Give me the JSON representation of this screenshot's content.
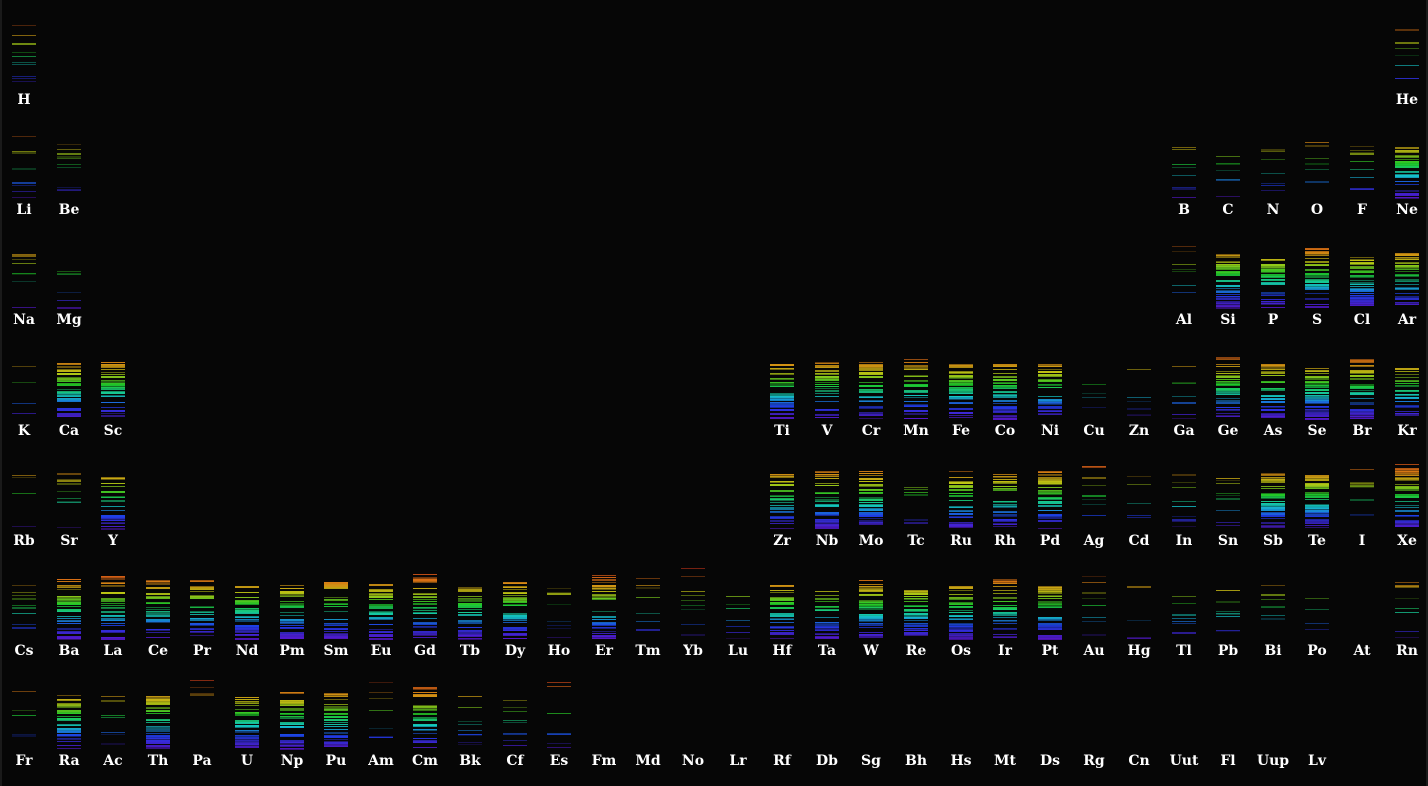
{
  "periodic_table": {
    "rows": [
      [
        "H",
        "",
        "",
        "",
        "",
        "",
        "",
        "",
        "",
        "",
        "",
        "",
        "",
        "",
        "",
        "",
        "",
        "",
        "",
        "",
        "",
        "",
        "",
        "",
        "",
        "",
        "",
        "",
        "",
        "",
        "",
        "He"
      ],
      [
        "Li",
        "Be",
        "",
        "",
        "",
        "",
        "",
        "",
        "",
        "",
        "",
        "",
        "",
        "",
        "",
        "",
        "",
        "",
        "",
        "",
        "",
        "",
        "",
        "",
        "",
        "",
        "B",
        "C",
        "N",
        "O",
        "F",
        "Ne"
      ],
      [
        "Na",
        "Mg",
        "",
        "",
        "",
        "",
        "",
        "",
        "",
        "",
        "",
        "",
        "",
        "",
        "",
        "",
        "",
        "",
        "",
        "",
        "",
        "",
        "",
        "",
        "",
        "",
        "Al",
        "Si",
        "P",
        "S",
        "Cl",
        "Ar"
      ],
      [
        "K",
        "Ca",
        "Sc",
        "",
        "",
        "",
        "",
        "",
        "",
        "",
        "",
        "",
        "",
        "",
        "",
        "",
        "",
        "Ti",
        "V",
        "Cr",
        "Mn",
        "Fe",
        "Co",
        "Ni",
        "Cu",
        "Zn",
        "Ga",
        "Ge",
        "As",
        "Se",
        "Br",
        "Kr"
      ],
      [
        "Rb",
        "Sr",
        "Y",
        "",
        "",
        "",
        "",
        "",
        "",
        "",
        "",
        "",
        "",
        "",
        "",
        "",
        "",
        "Zr",
        "Nb",
        "Mo",
        "Tc",
        "Ru",
        "Rh",
        "Pd",
        "Ag",
        "Cd",
        "In",
        "Sn",
        "Sb",
        "Te",
        "I",
        "Xe"
      ],
      [
        "Cs",
        "Ba",
        "La",
        "Ce",
        "Pr",
        "Nd",
        "Pm",
        "Sm",
        "Eu",
        "Gd",
        "Tb",
        "Dy",
        "Ho",
        "Er",
        "Tm",
        "Yb",
        "Lu",
        "Hf",
        "Ta",
        "W",
        "Re",
        "Os",
        "Ir",
        "Pt",
        "Au",
        "Hg",
        "Tl",
        "Pb",
        "Bi",
        "Po",
        "At",
        "Rn"
      ],
      [
        "Fr",
        "Ra",
        "Ac",
        "Th",
        "Pa",
        "U",
        "Np",
        "Pu",
        "Am",
        "Cm",
        "Bk",
        "Cf",
        "Es",
        "Fm",
        "Md",
        "No",
        "Lr",
        "Rf",
        "Db",
        "Sg",
        "Bh",
        "Hs",
        "Mt",
        "Ds",
        "Rg",
        "Cn",
        "Uut",
        "Fl",
        "Uup",
        "Lv",
        "",
        ""
      ]
    ],
    "dense_spectra": [
      "Ti",
      "V",
      "Mn",
      "Fe",
      "Co",
      "Ni",
      "Mo",
      "Nb",
      "Ru",
      "Rh",
      "Ce",
      "Pr",
      "Nd",
      "Pm",
      "Sm",
      "Eu",
      "Gd",
      "Tb",
      "Dy",
      "Er",
      "Hf",
      "Ta",
      "W",
      "Os",
      "Ir",
      "Th",
      "U",
      "Pu",
      "Cm",
      "Ar",
      "Xe",
      "Br",
      "Se",
      "S",
      "P",
      "Cl",
      "Si",
      "Ne",
      "Ca",
      "Zr",
      "Sc",
      "Y",
      "La",
      "Re",
      "Pt",
      "Ba",
      "Ra",
      "Np",
      "Kr",
      "Ge",
      "As",
      "Sb",
      "Te",
      "Pd",
      "Cr"
    ],
    "empty_spectra": [
      "Fm",
      "Md",
      "No",
      "Lr",
      "Rf",
      "Db",
      "Sg",
      "Bh",
      "Hs",
      "Mt",
      "Ds",
      "Rg",
      "Cn",
      "Uut",
      "Fl",
      "Uup",
      "Lv",
      "At"
    ]
  }
}
